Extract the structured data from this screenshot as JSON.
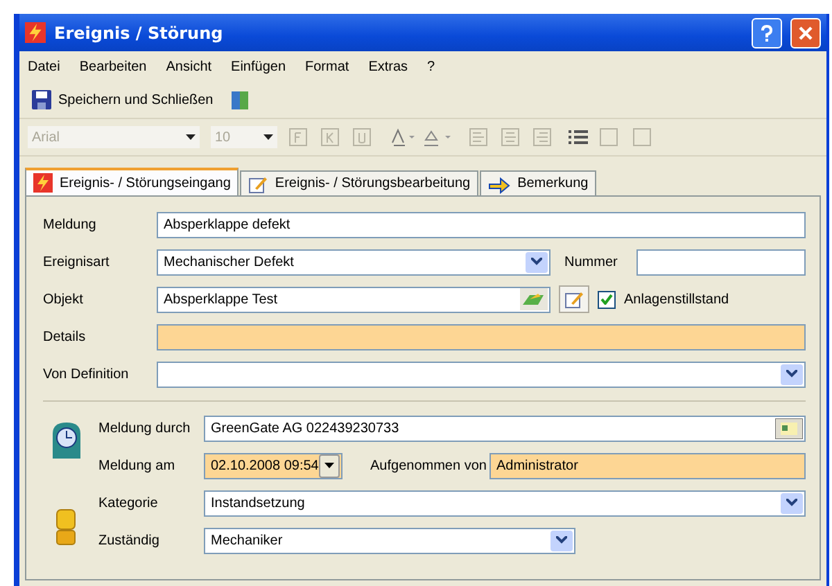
{
  "window": {
    "title": "Ereignis / Störung"
  },
  "menu": [
    "Datei",
    "Bearbeiten",
    "Ansicht",
    "Einfügen",
    "Format",
    "Extras",
    "?"
  ],
  "toolbar": {
    "save_label": "Speichern und Schließen"
  },
  "format_toolbar": {
    "disabled": true,
    "font": "Arial",
    "size": "10"
  },
  "tabs": [
    {
      "label": "Ereignis- / Störungseingang",
      "selected": true,
      "kind": "bolt"
    },
    {
      "label": "Ereignis- / Störungsbearbeitung",
      "selected": false,
      "kind": "note"
    },
    {
      "label": "Bemerkung",
      "selected": false,
      "kind": "arrow"
    }
  ],
  "form": {
    "meldung": {
      "label": "Meldung",
      "value": "Absperklappe defekt"
    },
    "ereignisart": {
      "label": "Ereignisart",
      "value": "Mechanischer Defekt"
    },
    "nummer": {
      "label": "Nummer"
    },
    "objekt": {
      "label": "Objekt",
      "value": "Absperklappe Test"
    },
    "anlagenstillstand": {
      "label": "Anlagenstillstand",
      "checked": true
    },
    "details": {
      "label": "Details",
      "highlighted": true
    },
    "von_definition": {
      "label": "Von Definition"
    }
  },
  "report": {
    "meldung_durch": {
      "label": "Meldung durch",
      "value": "GreenGate AG 022439230733"
    },
    "meldung_am": {
      "label": "Meldung am",
      "value": "02.10.2008 09:54",
      "highlighted": true
    },
    "aufgenommen_von": {
      "label": "Aufgenommen von",
      "value": "Administrator",
      "highlighted": true
    },
    "kategorie": {
      "label": "Kategorie",
      "value": "Instandsetzung"
    },
    "zustaendig": {
      "label": "Zuständig",
      "value": "Mechaniker"
    }
  }
}
